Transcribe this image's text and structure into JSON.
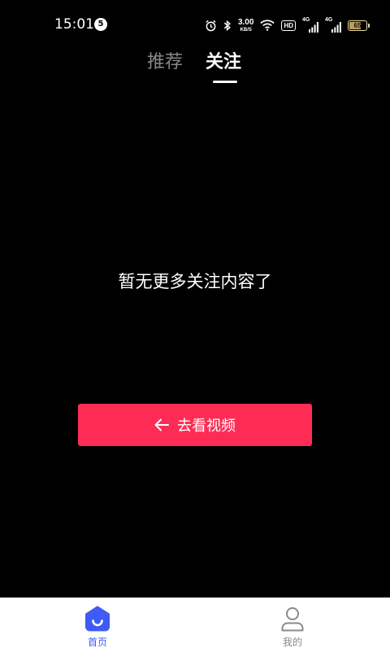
{
  "status_bar": {
    "time": "15:01",
    "notification_count": "5",
    "net_speed_value": "3.00",
    "net_speed_unit": "KB/S",
    "hd_label": "HD",
    "signal_1_label": "4G",
    "signal_2_label": "4G",
    "battery_level": "65",
    "battery_level_fraction": 0.65,
    "icons": [
      "alarm-icon",
      "bluetooth-icon",
      "net-speed",
      "wifi-icon",
      "hd-icon",
      "signal-icon",
      "signal-icon",
      "battery-icon"
    ]
  },
  "tabs": {
    "recommend": "推荐",
    "follow": "关注",
    "active": "follow"
  },
  "empty_state": {
    "message": "暂无更多关注内容了",
    "button_label": "去看视频",
    "button_icon": "arrow-left-icon"
  },
  "bottom_nav": {
    "items": [
      {
        "label": "首页",
        "icon": "home-icon",
        "active": true
      },
      {
        "label": "我的",
        "icon": "user-icon",
        "active": false
      }
    ]
  },
  "colors": {
    "background": "#000000",
    "accent_button": "#fe2c55",
    "nav_active": "#3f5bf3",
    "nav_inactive": "#888888",
    "tab_inactive": "#888888"
  }
}
